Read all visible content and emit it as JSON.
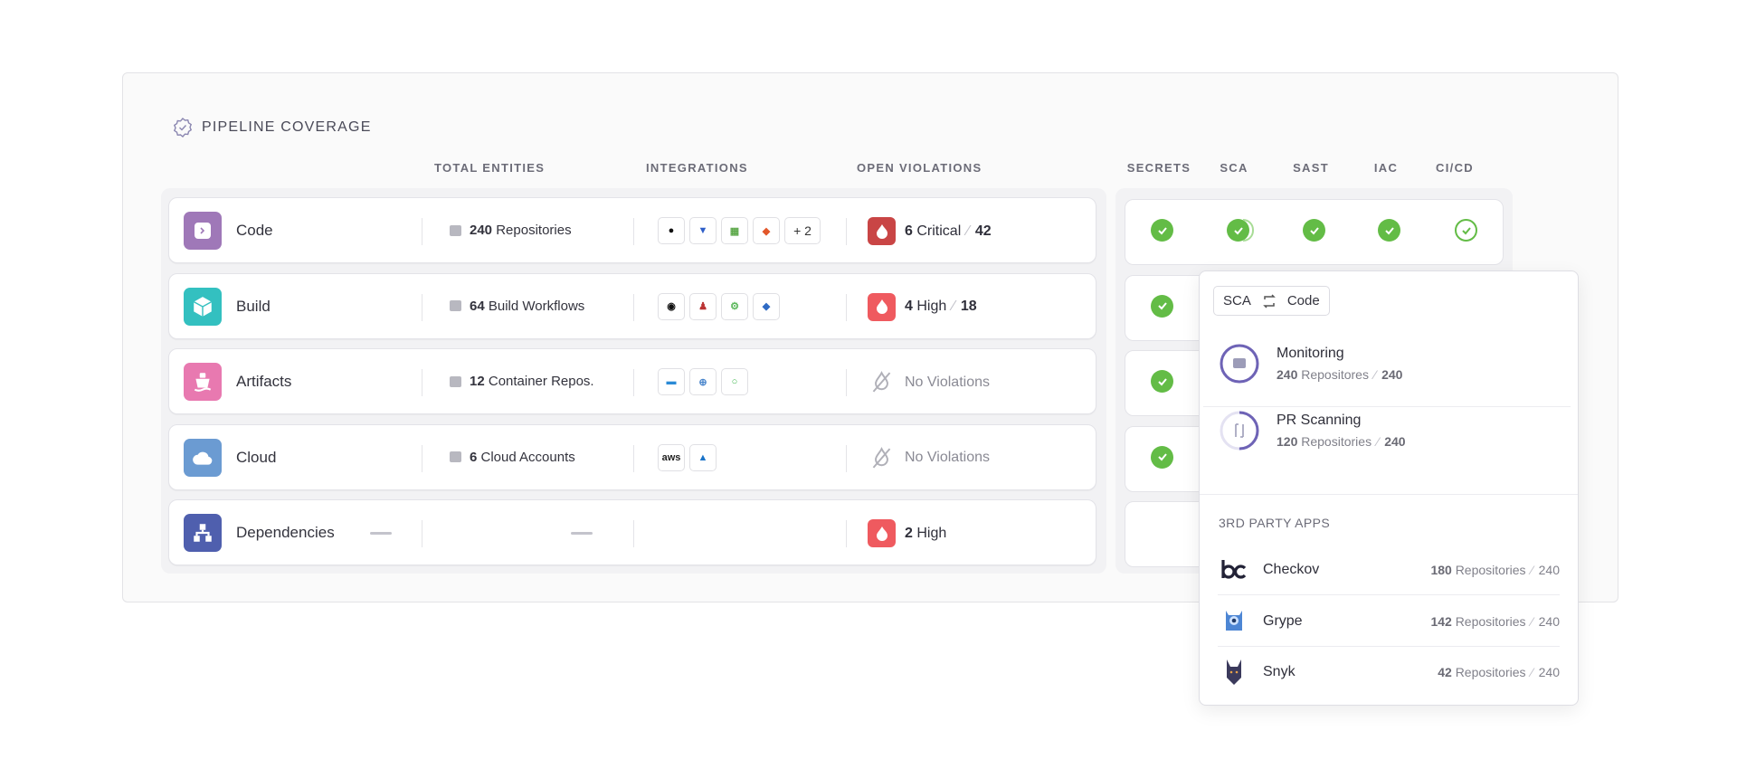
{
  "title": "PIPELINE COVERAGE",
  "headers": {
    "total_entities": "TOTAL ENTITIES",
    "integrations": "INTEGRATIONS",
    "open_violations": "OPEN VIOLATIONS"
  },
  "coverage_headers": [
    "SECRETS",
    "SCA",
    "SAST",
    "IAC",
    "CI/CD"
  ],
  "colors": {
    "check": "#63bc46",
    "critical": "#c94545",
    "high": "#ef5a5f",
    "ring": "#6e63b6"
  },
  "rows": [
    {
      "label": "Code",
      "color": "#9f78b8",
      "icon": "terminal-icon",
      "entity_icon": "folder-icon",
      "entity_count": "240",
      "entity_label": "Repositories",
      "integrations": [
        "github",
        "bitbucket",
        "gitea",
        "gitlab"
      ],
      "more": "+ 2",
      "violation": {
        "count": "6",
        "severity": "Critical",
        "total": "42",
        "level": "critical"
      },
      "coverage": [
        "check",
        "check-active",
        "check",
        "check",
        "check-outline"
      ]
    },
    {
      "label": "Build",
      "color": "#33c0c0",
      "icon": "box-icon",
      "entity_icon": "workflow-icon",
      "entity_count": "64",
      "entity_label": "Build Workflows",
      "integrations": [
        "circleci",
        "jenkins",
        "gocd",
        "azure-pipelines"
      ],
      "violation": {
        "count": "4",
        "severity": "High",
        "total": "18",
        "level": "high"
      },
      "coverage": [
        "check"
      ]
    },
    {
      "label": "Artifacts",
      "color": "#e879b0",
      "icon": "ship-icon",
      "entity_icon": "container-icon",
      "entity_count": "12",
      "entity_label": "Container Repos.",
      "integrations": [
        "docker",
        "harbor",
        "nexus"
      ],
      "violation": {
        "none": "No Violations"
      },
      "coverage": [
        "check"
      ]
    },
    {
      "label": "Cloud",
      "color": "#6b9bd2",
      "icon": "cloud-icon",
      "entity_icon": "cloud-icon",
      "entity_count": "6",
      "entity_label": "Cloud Accounts",
      "integrations": [
        "aws",
        "azure"
      ],
      "violation": {
        "none": "No Violations"
      },
      "coverage": [
        "check"
      ]
    },
    {
      "label": "Dependencies",
      "color": "#4f5fae",
      "icon": "dependencies-icon",
      "violation": {
        "count": "2",
        "severity": "High",
        "level": "high"
      },
      "coverage": []
    }
  ],
  "popup": {
    "chip": {
      "left": "SCA",
      "right": "Code"
    },
    "items": [
      {
        "title": "Monitoring",
        "count": "240",
        "label": "Repositores",
        "total": "240",
        "progress": 1.0,
        "icon": "folder-icon"
      },
      {
        "title": "PR Scanning",
        "count": "120",
        "label": "Repositories",
        "total": "240",
        "progress": 0.5,
        "icon": "pull-request-icon"
      }
    ],
    "section": "3RD PARTY APPS",
    "apps": [
      {
        "name": "Checkov",
        "count": "180",
        "label": "Repositories",
        "total": "240"
      },
      {
        "name": "Grype",
        "count": "142",
        "label": "Repositories",
        "total": "240"
      },
      {
        "name": "Snyk",
        "count": "42",
        "label": "Repositories",
        "total": "240"
      }
    ]
  }
}
